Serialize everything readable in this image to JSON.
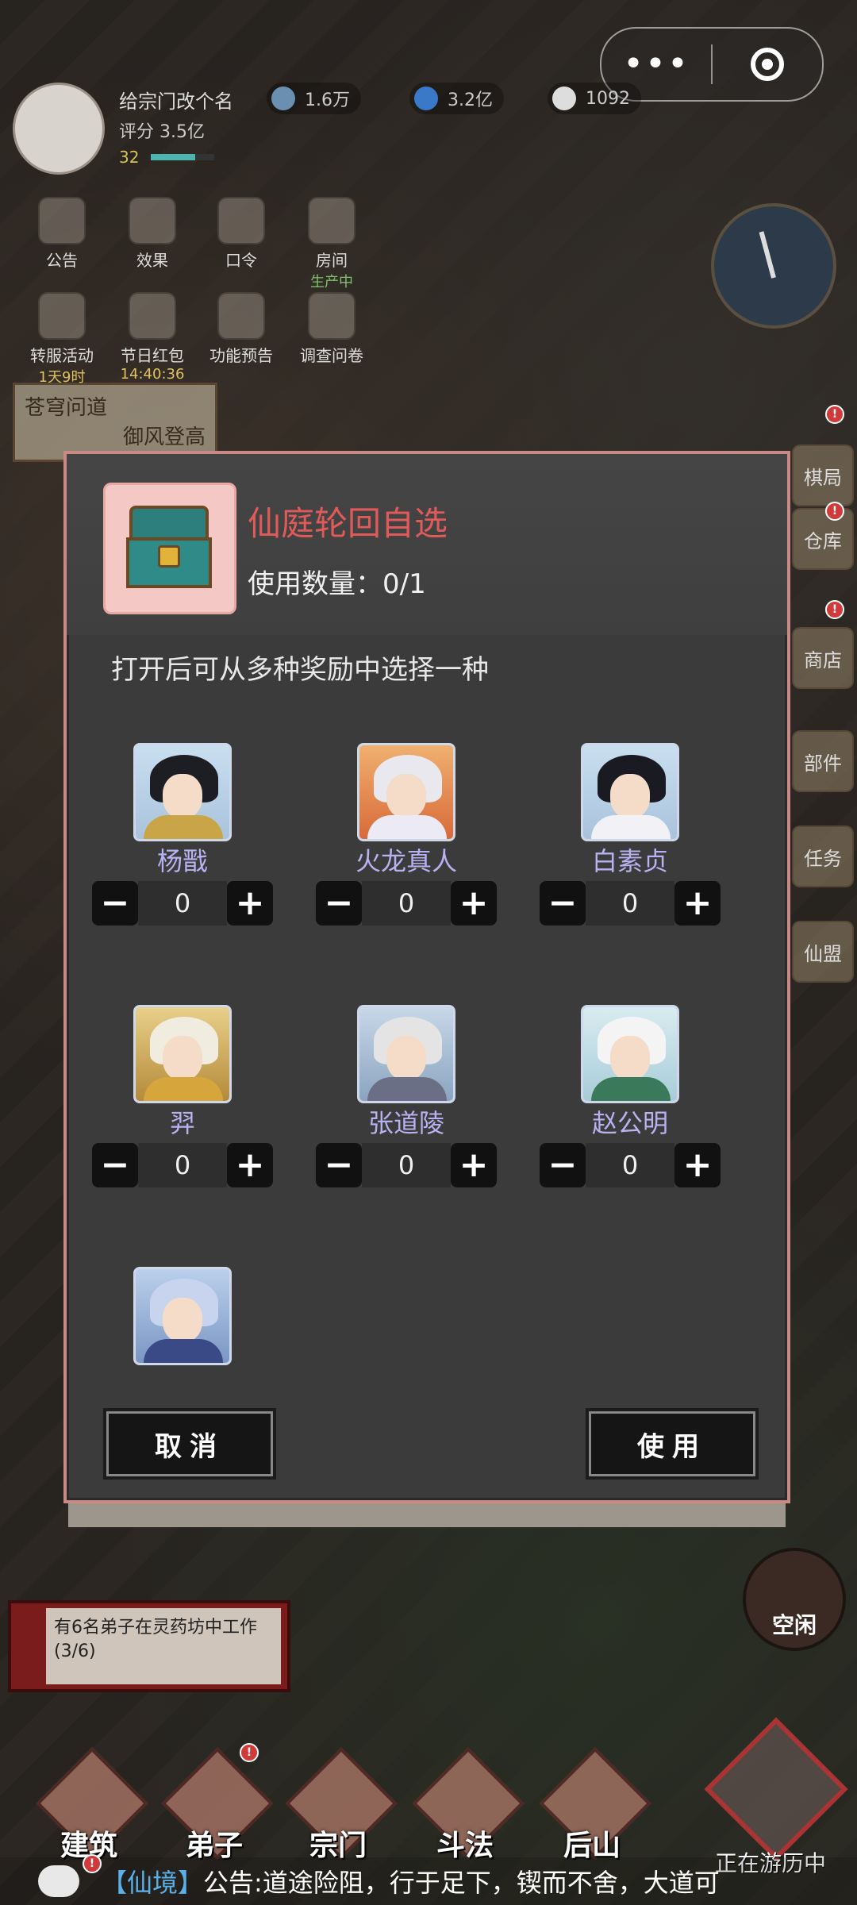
{
  "header": {
    "player_name": "给宗门改个名",
    "score": "评分 3.5亿",
    "level": "32",
    "resources": [
      "1.6万",
      "3.2亿",
      "1092"
    ]
  },
  "menu": [
    {
      "label": "公告"
    },
    {
      "label": "效果"
    },
    {
      "label": "口令"
    },
    {
      "label": "房间",
      "sub": "生产中"
    },
    {
      "label": "转服活动",
      "sub": "1天9时"
    },
    {
      "label": "节日红包",
      "sub": "14:40:36"
    },
    {
      "label": "功能预告"
    },
    {
      "label": "调查问卷"
    }
  ],
  "banner": {
    "line1": "苍穹问道",
    "line2": "御风登高"
  },
  "side_buttons": [
    "棋局",
    "仓库",
    "商店",
    "部件",
    "任务",
    "仙盟"
  ],
  "dialog": {
    "title": "仙庭轮回自选",
    "count_label": "使用数量：0/1",
    "description": "打开后可从多种奖励中选择一种",
    "choices": [
      {
        "name": "杨戬",
        "qty": "0"
      },
      {
        "name": "火龙真人",
        "qty": "0"
      },
      {
        "name": "白素贞",
        "qty": "0"
      },
      {
        "name": "羿",
        "qty": "0"
      },
      {
        "name": "张道陵",
        "qty": "0"
      },
      {
        "name": "赵公明",
        "qty": "0"
      },
      {
        "name": "",
        "qty": ""
      }
    ],
    "cancel_label": "取消",
    "use_label": "使用"
  },
  "task_card": {
    "text": "有6名弟子在灵药坊中工作(3/6)"
  },
  "gourd_label": "空闲",
  "bottom_nav": [
    "建筑",
    "弟子",
    "宗门",
    "斗法",
    "后山"
  ],
  "travel_label": "正在游历中",
  "ticker": {
    "tag": "【仙境】",
    "message": "公告:道途险阻，行于足下，锲而不舍，大道可"
  },
  "colors": {
    "title_red": "#e05a5a",
    "name_purple": "#b8b2f2",
    "border_pink": "#c98a86"
  }
}
